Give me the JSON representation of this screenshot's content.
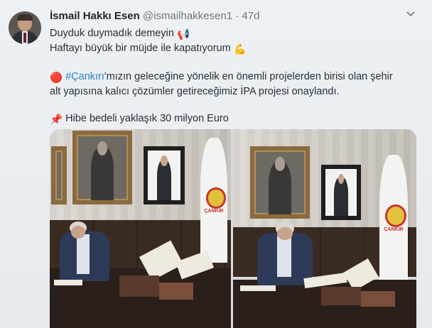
{
  "tweet": {
    "author_name": "İsmail Hakkı Esen",
    "handle": "@ismailhakkesen1",
    "separator": "·",
    "age": "47d",
    "menu_icon": "chevron-down-icon",
    "lines": {
      "l1": "Duyduk duymadık demeyin",
      "l1_emoji": "📢",
      "l2": "Haftayı büyük bir müjde ile kapatıyorum",
      "l2_emoji": "💪",
      "l3_emoji": "🔴",
      "l3_hashtag": "#Çankırı",
      "l3_rest": "'mızın geleceğine yönelik en önemli projelerden birisi olan şehir",
      "l4": "alt yapısına kalıcı çözümler getireceğimiz İPA projesi onaylandı.",
      "l5_emoji": "📌",
      "l5": "Hibe bedeli yaklaşık 30 milyon Euro"
    },
    "media": {
      "flag_text_left": "ÇANKIR",
      "flag_text_right": "ÇANKIR"
    },
    "colors": {
      "link": "#2a83c8",
      "muted": "#6b7882",
      "text": "#22303a"
    }
  }
}
